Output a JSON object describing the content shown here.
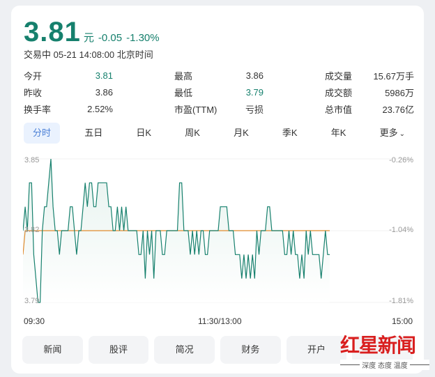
{
  "quote": {
    "price": "3.81",
    "unit": "元",
    "change": "-0.05",
    "change_pct": "-1.30%",
    "status": "交易中 05-21 14:08:00 北京时间"
  },
  "stats": [
    [
      {
        "label": "今开",
        "value": "3.81",
        "green": true
      },
      {
        "label": "最高",
        "value": "3.86",
        "green": false
      },
      {
        "label": "成交量",
        "value": "15.67万手",
        "green": false
      }
    ],
    [
      {
        "label": "昨收",
        "value": "3.86",
        "green": false
      },
      {
        "label": "最低",
        "value": "3.79",
        "green": true
      },
      {
        "label": "成交额",
        "value": "5986万",
        "green": false
      }
    ],
    [
      {
        "label": "换手率",
        "value": "2.52%",
        "green": false
      },
      {
        "label": "市盈(TTM)",
        "value": "亏损",
        "green": false
      },
      {
        "label": "总市值",
        "value": "23.76亿",
        "green": false
      }
    ]
  ],
  "tabs": [
    "分时",
    "五日",
    "日K",
    "周K",
    "月K",
    "季K",
    "年K",
    "更多"
  ],
  "active_tab": 0,
  "chart_data": {
    "type": "line",
    "y_left_ticks": [
      "3.85",
      "3.82",
      "3.79"
    ],
    "y_right_ticks": [
      "-0.26%",
      "-1.04%",
      "-1.81%"
    ],
    "ylim": [
      3.79,
      3.85
    ],
    "prev_close": 3.86,
    "x_labels": [
      "09:30",
      "11:30/13:00",
      "15:00"
    ],
    "colors": {
      "price": "#16806d",
      "avg": "#e08a2c",
      "prev_close": "#e36e6e"
    },
    "price": [
      3.82,
      3.83,
      3.82,
      3.84,
      3.84,
      3.81,
      3.8,
      3.79,
      3.79,
      3.82,
      3.83,
      3.83,
      3.84,
      3.85,
      3.83,
      3.82,
      3.82,
      3.81,
      3.82,
      3.82,
      3.82,
      3.82,
      3.83,
      3.83,
      3.82,
      3.81,
      3.82,
      3.82,
      3.83,
      3.84,
      3.83,
      3.84,
      3.84,
      3.83,
      3.83,
      3.84,
      3.84,
      3.84,
      3.84,
      3.84,
      3.83,
      3.83,
      3.82,
      3.82,
      3.83,
      3.82,
      3.83,
      3.82,
      3.83,
      3.82,
      3.82,
      3.82,
      3.82,
      3.82,
      3.81,
      3.81,
      3.82,
      3.8,
      3.82,
      3.81,
      3.82,
      3.8,
      3.82,
      3.82,
      3.82,
      3.81,
      3.81,
      3.82,
      3.82,
      3.82,
      3.82,
      3.82,
      3.82,
      3.84,
      3.84,
      3.82,
      3.82,
      3.82,
      3.81,
      3.82,
      3.81,
      3.82,
      3.81,
      3.82,
      3.82,
      3.81,
      3.81,
      3.82,
      3.82,
      3.82,
      3.82,
      3.82,
      3.83,
      3.83,
      3.83,
      3.83,
      3.82,
      3.82,
      3.82,
      3.81,
      3.81,
      3.81,
      3.8,
      3.81,
      3.8,
      3.81,
      3.8,
      3.81,
      3.8,
      3.82,
      3.81,
      3.82,
      3.82,
      3.82,
      3.83,
      3.83,
      3.82,
      3.82,
      3.82,
      3.82,
      3.82,
      3.82,
      3.81,
      3.81,
      3.82,
      3.81,
      3.82,
      3.81,
      3.81,
      3.8,
      3.81,
      3.8,
      3.82,
      3.81,
      3.82,
      3.81,
      3.81,
      3.81,
      3.81,
      3.8,
      3.81,
      3.82,
      3.81,
      3.81
    ],
    "average": [
      3.81,
      3.82,
      3.82,
      3.82,
      3.82,
      3.82,
      3.82,
      3.82,
      3.82,
      3.82,
      3.82,
      3.82,
      3.82,
      3.82,
      3.82,
      3.82,
      3.82,
      3.82,
      3.82,
      3.82,
      3.82,
      3.82,
      3.82,
      3.82,
      3.82,
      3.82,
      3.82,
      3.82,
      3.82,
      3.82,
      3.82,
      3.82,
      3.82,
      3.82,
      3.82,
      3.82,
      3.82,
      3.82,
      3.82,
      3.82,
      3.82,
      3.82,
      3.82,
      3.82,
      3.82,
      3.82,
      3.82,
      3.82,
      3.82,
      3.82,
      3.82,
      3.82,
      3.82,
      3.82,
      3.82,
      3.82,
      3.82,
      3.82,
      3.82,
      3.82,
      3.82,
      3.82,
      3.82,
      3.82,
      3.82,
      3.82,
      3.82,
      3.82,
      3.82,
      3.82,
      3.82,
      3.82,
      3.82,
      3.82,
      3.82,
      3.82,
      3.82,
      3.82,
      3.82,
      3.82,
      3.82,
      3.82,
      3.82,
      3.82,
      3.82,
      3.82,
      3.82,
      3.82,
      3.82,
      3.82,
      3.82,
      3.82,
      3.82,
      3.82,
      3.82,
      3.82,
      3.82,
      3.82,
      3.82,
      3.82,
      3.82,
      3.82,
      3.82,
      3.82,
      3.82,
      3.82,
      3.82,
      3.82,
      3.82,
      3.82,
      3.82,
      3.82,
      3.82,
      3.82,
      3.82,
      3.82,
      3.82,
      3.82,
      3.82,
      3.82,
      3.82,
      3.82,
      3.82,
      3.82,
      3.82,
      3.82,
      3.82,
      3.82,
      3.82,
      3.82,
      3.82,
      3.82,
      3.82,
      3.82,
      3.82,
      3.82,
      3.82,
      3.82,
      3.82,
      3.82,
      3.82,
      3.82,
      3.82,
      3.82
    ]
  },
  "bottom_tabs": [
    "新闻",
    "股评",
    "简况",
    "财务",
    "开户"
  ],
  "watermark": {
    "title": "红星新闻",
    "slogan": "深度 态度 温度"
  }
}
